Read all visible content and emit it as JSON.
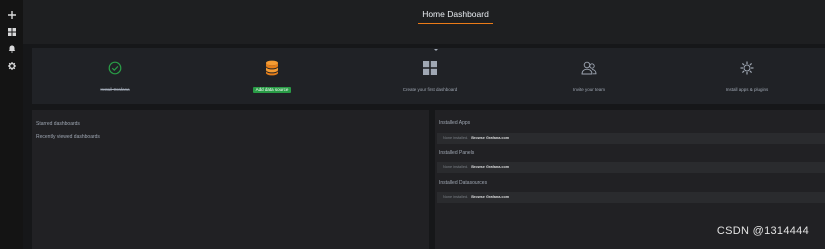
{
  "header": {
    "title": "Home Dashboard"
  },
  "steps": [
    {
      "label": "Install Grafana",
      "state": "done",
      "icon": "check-circle-icon"
    },
    {
      "label": "Add data source",
      "state": "active",
      "icon": "database-icon"
    },
    {
      "label": "Create your first dashboard",
      "state": "todo",
      "icon": "dashboard-grid-icon"
    },
    {
      "label": "Invite your team",
      "state": "todo",
      "icon": "users-icon"
    },
    {
      "label": "Install apps & plugins",
      "state": "todo",
      "icon": "plugins-icon"
    }
  ],
  "left_panel": {
    "starred": "Starred dashboards",
    "recent": "Recently viewed dashboards"
  },
  "right_panel": {
    "sections": [
      {
        "title": "Installed Apps",
        "none_text": "None installed.",
        "browse_text": "Browse Grafana.com"
      },
      {
        "title": "Installed Panels",
        "none_text": "None installed.",
        "browse_text": "Browse Grafana.com"
      },
      {
        "title": "Installed Datasources",
        "none_text": "None installed.",
        "browse_text": "Browse Grafana.com"
      }
    ]
  },
  "watermark": "CSDN @1314444",
  "colors": {
    "accent": "#eb7b18",
    "success": "#299c46",
    "database": "#f59c33"
  }
}
